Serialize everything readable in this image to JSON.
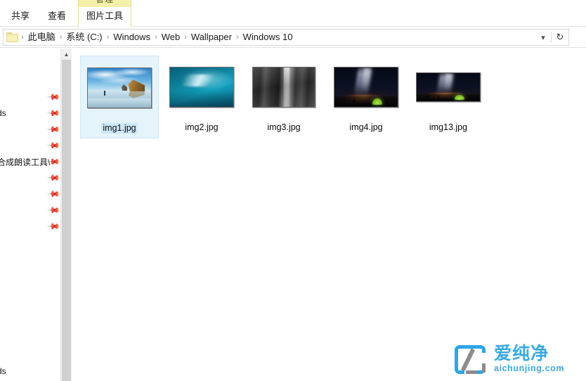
{
  "ribbon": {
    "contextual_group_label": "管理",
    "tabs": [
      {
        "label": "共享",
        "active": false
      },
      {
        "label": "查看",
        "active": false
      },
      {
        "label": "图片工具",
        "active": true
      }
    ]
  },
  "address_bar": {
    "folder_icon": "folder-icon",
    "breadcrumbs": [
      "此电脑",
      "系统 (C:)",
      "Windows",
      "Web",
      "Wallpaper",
      "Windows 10"
    ],
    "separator": "›",
    "dropdown_icon": "chevron-down-icon",
    "refresh_icon": "refresh-icon"
  },
  "nav_pane": {
    "scroll_up_icon": "chevron-up-icon",
    "items": [
      {
        "label": "",
        "pinned": true
      },
      {
        "label": "ds",
        "pinned": true
      },
      {
        "label": "",
        "pinned": true
      },
      {
        "label": "",
        "pinned": true
      },
      {
        "label": "合成朗读工具\\",
        "pinned": true
      },
      {
        "label": "",
        "pinned": true
      },
      {
        "label": "",
        "pinned": true
      },
      {
        "label": "",
        "pinned": true
      },
      {
        "label": "",
        "pinned": true
      },
      {
        "label": "",
        "pinned": false
      },
      {
        "label": "ds",
        "pinned": false
      }
    ]
  },
  "files": [
    {
      "name": "img1.jpg",
      "selected": true,
      "scene": "beach",
      "thumb_w": 92,
      "thumb_h": 58
    },
    {
      "name": "img2.jpg",
      "selected": false,
      "scene": "underwater",
      "thumb_w": 92,
      "thumb_h": 58
    },
    {
      "name": "img3.jpg",
      "selected": false,
      "scene": "rockface",
      "thumb_w": 90,
      "thumb_h": 58
    },
    {
      "name": "img4.jpg",
      "selected": false,
      "scene": "night",
      "thumb_w": 92,
      "thumb_h": 58
    },
    {
      "name": "img13.jpg",
      "selected": false,
      "scene": "night",
      "thumb_w": 92,
      "thumb_h": 42
    }
  ],
  "watermark": {
    "cn": "爱纯净",
    "en": "aichunjing.com",
    "brand_color": "#3aa9e5",
    "logo_icon": "aichunjing-logo-icon"
  }
}
